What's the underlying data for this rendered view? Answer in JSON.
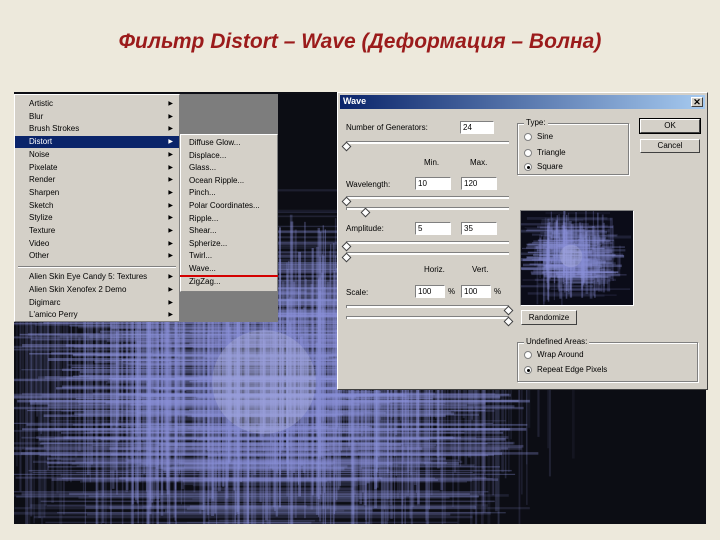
{
  "slide": {
    "title": "Фильтр Distort – Wave (Деформация – Волна)"
  },
  "menu": {
    "items": [
      {
        "label": "Artistic",
        "has_submenu": true,
        "selected": false
      },
      {
        "label": "Blur",
        "has_submenu": true,
        "selected": false
      },
      {
        "label": "Brush Strokes",
        "has_submenu": true,
        "selected": false
      },
      {
        "label": "Distort",
        "has_submenu": true,
        "selected": true
      },
      {
        "label": "Noise",
        "has_submenu": true,
        "selected": false
      },
      {
        "label": "Pixelate",
        "has_submenu": true,
        "selected": false
      },
      {
        "label": "Render",
        "has_submenu": true,
        "selected": false
      },
      {
        "label": "Sharpen",
        "has_submenu": true,
        "selected": false
      },
      {
        "label": "Sketch",
        "has_submenu": true,
        "selected": false
      },
      {
        "label": "Stylize",
        "has_submenu": true,
        "selected": false
      },
      {
        "label": "Texture",
        "has_submenu": true,
        "selected": false
      },
      {
        "label": "Video",
        "has_submenu": true,
        "selected": false
      },
      {
        "label": "Other",
        "has_submenu": true,
        "selected": false
      }
    ],
    "plugins": [
      {
        "label": "Alien Skin Eye Candy 5: Textures",
        "has_submenu": true
      },
      {
        "label": "Alien Skin Xenofex 2 Demo",
        "has_submenu": true
      },
      {
        "label": "Digimarc",
        "has_submenu": true
      },
      {
        "label": "L'amico Perry",
        "has_submenu": true
      }
    ],
    "arrow_glyph": "▶"
  },
  "submenu": {
    "items": [
      "Diffuse Glow...",
      "Displace...",
      "Glass...",
      "Ocean Ripple...",
      "Pinch...",
      "Polar Coordinates...",
      "Ripple...",
      "Shear...",
      "Spherize...",
      "Twirl...",
      "Wave...",
      "ZigZag..."
    ],
    "highlighted": "Wave..."
  },
  "dialog": {
    "title": "Wave",
    "close_glyph": "✕",
    "generators_label": "Number of Generators:",
    "generators_value": "24",
    "generators_level": 0.0,
    "min_header": "Min.",
    "max_header": "Max.",
    "wavelength_label": "Wavelength:",
    "wavelength_min": "10",
    "wavelength_max": "120",
    "wavelength_min_level": 0.0,
    "wavelength_max_level": 0.12,
    "amplitude_label": "Amplitude:",
    "amplitude_min": "5",
    "amplitude_max": "35",
    "amplitude_min_level": 0.0,
    "amplitude_max_level": 0.0,
    "horiz_header": "Horiz.",
    "vert_header": "Vert.",
    "scale_label": "Scale:",
    "scale_horiz": "100",
    "scale_vert": "100",
    "percent_sign": "%",
    "scale_horiz_level": 1.0,
    "scale_vert_level": 1.0,
    "ok_label": "OK",
    "cancel_label": "Cancel",
    "type_group": "Type:",
    "type_options": [
      {
        "label": "Sine",
        "checked": false
      },
      {
        "label": "Triangle",
        "checked": false
      },
      {
        "label": "Square",
        "checked": true
      }
    ],
    "randomize_label": "Randomize",
    "undefined_group": "Undefined Areas:",
    "undefined_options": [
      {
        "label": "Wrap Around",
        "checked": false
      },
      {
        "label": "Repeat Edge Pixels",
        "checked": true
      }
    ]
  },
  "colors": {
    "title_red": "#9b1b1b",
    "selection_blue": "#0a246a",
    "dialog_grey": "#d4d0c8",
    "highlight_line": "#d40000",
    "artwork_dark": "#0c0d14",
    "artwork_light": "#8a90d8"
  }
}
